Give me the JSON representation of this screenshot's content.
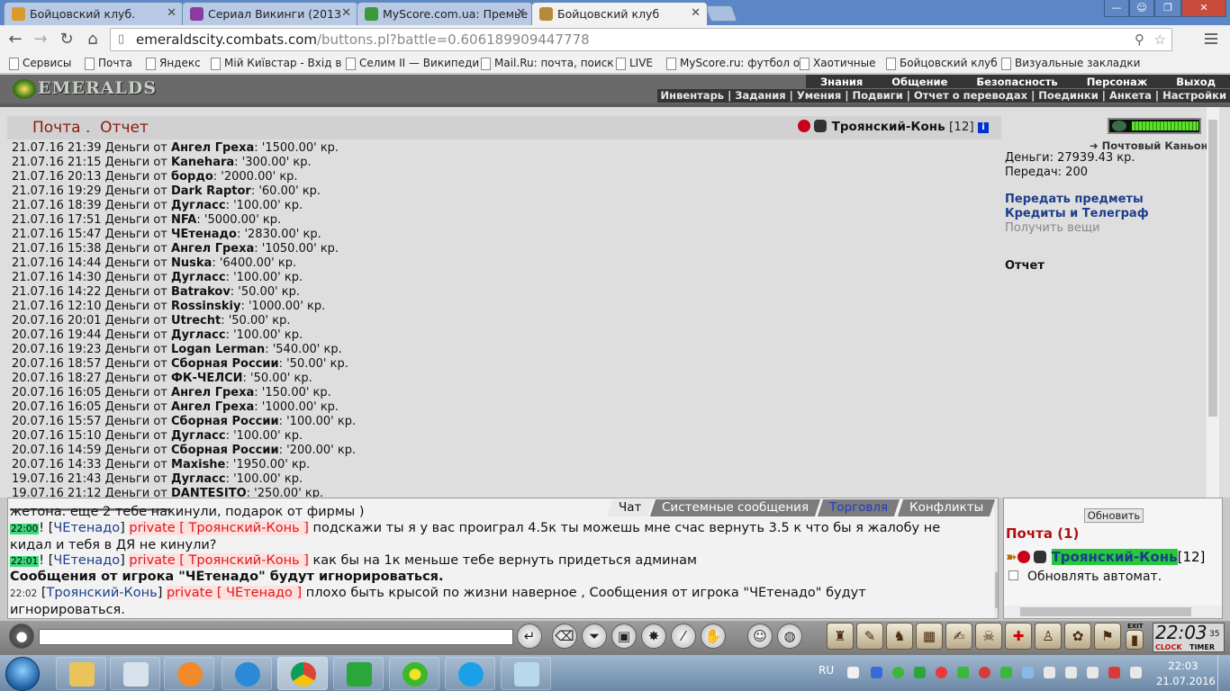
{
  "browser": {
    "tabs": [
      {
        "title": "Бойцовский клуб.",
        "icon_color": "#d89a2a"
      },
      {
        "title": "Сериал Викинги (2013",
        "icon_color": "#8a3aa0"
      },
      {
        "title": "MyScore.com.ua: Премье",
        "icon_color": "#3a9a3a"
      },
      {
        "title": "Бойцовский клуб",
        "icon_color": "#b58a3a"
      }
    ],
    "url_domain": "emeraldscity.combats.com",
    "url_path": "/buttons.pl?battle=0.606189909447778",
    "bookmarks": [
      "Сервисы",
      "Почта",
      "Яндекс",
      "Мій Київстар - Вхід в",
      "Селим II — Википеди",
      "Mail.Ru: почта, поиск",
      "LIVE",
      "MyScore.ru: футбол о",
      "Хаотичные",
      "Бойцовский клуб",
      "Визуальные закладки"
    ]
  },
  "game": {
    "logo": "EMERALDS",
    "top_menu": [
      "Знания",
      "Общение",
      "Безопасность",
      "Персонаж",
      "Выход"
    ],
    "sub_menu": [
      "Инвентарь",
      "Задания",
      "Умения",
      "Подвиги",
      "Отчет о переводах",
      "Поединки",
      "Анкета",
      "Настройки"
    ],
    "page_title_a": "Почта .",
    "page_title_b": "Отчет",
    "player_name": "Троянский-Конь",
    "player_level": "[12]",
    "info_icon": "i",
    "location": "Почтовый Каньон",
    "money_line": "Деньги: 27939.43 кр.",
    "transfers_line": "Передач: 200",
    "links": [
      "Передать предметы",
      "Кредиты и Телеграф"
    ],
    "disabled_link": "Получить вещи",
    "report_label": "Отчет",
    "log": [
      {
        "date": "21.07.16 21:39 Деньги от",
        "name": "Ангел Греха",
        "amount": ": '1500.00' кр."
      },
      {
        "date": "21.07.16 21:15 Деньги от",
        "name": "Kanehara",
        "amount": ": '300.00' кр."
      },
      {
        "date": "21.07.16 20:13 Деньги от",
        "name": "бордо",
        "amount": ": '2000.00' кр."
      },
      {
        "date": "21.07.16 19:29 Деньги от",
        "name": "Dark Raptor",
        "amount": ": '60.00' кр."
      },
      {
        "date": "21.07.16 18:39 Деньги от",
        "name": "Дугласс",
        "amount": ": '100.00' кр."
      },
      {
        "date": "21.07.16 17:51 Деньги от",
        "name": "NFA",
        "amount": ": '5000.00' кр."
      },
      {
        "date": "21.07.16 15:47 Деньги от",
        "name": "ЧЕтенадо",
        "amount": ": '2830.00' кр."
      },
      {
        "date": "21.07.16 15:38 Деньги от",
        "name": "Ангел Греха",
        "amount": ": '1050.00' кр."
      },
      {
        "date": "21.07.16 14:44 Деньги от",
        "name": "Nuska",
        "amount": ": '6400.00' кр."
      },
      {
        "date": "21.07.16 14:30 Деньги от",
        "name": "Дугласс",
        "amount": ": '100.00' кр."
      },
      {
        "date": "21.07.16 14:22 Деньги от",
        "name": "Batrakov",
        "amount": ": '50.00' кр."
      },
      {
        "date": "21.07.16 12:10 Деньги от",
        "name": "Rossinskiy",
        "amount": ": '1000.00' кр."
      },
      {
        "date": "20.07.16 20:01 Деньги от",
        "name": "Utrecht",
        "amount": ": '50.00' кр."
      },
      {
        "date": "20.07.16 19:44 Деньги от",
        "name": "Дугласс",
        "amount": ": '100.00' кр."
      },
      {
        "date": "20.07.16 19:23 Деньги от",
        "name": "Logan Lerman",
        "amount": ": '540.00' кр."
      },
      {
        "date": "20.07.16 18:57 Деньги от",
        "name": "Сборная России",
        "amount": ": '50.00' кр."
      },
      {
        "date": "20.07.16 18:27 Деньги от",
        "name": "ФК-ЧЕЛСИ",
        "amount": ": '50.00' кр."
      },
      {
        "date": "20.07.16 16:05 Деньги от",
        "name": "Ангел Греха",
        "amount": ": '150.00' кр."
      },
      {
        "date": "20.07.16 16:05 Деньги от",
        "name": "Ангел Греха",
        "amount": ": '1000.00' кр."
      },
      {
        "date": "20.07.16 15:57 Деньги от",
        "name": "Сборная России",
        "amount": ": '100.00' кр."
      },
      {
        "date": "20.07.16 15:10 Деньги от",
        "name": "Дугласс",
        "amount": ": '100.00' кр."
      },
      {
        "date": "20.07.16 14:59 Деньги от",
        "name": "Сборная России",
        "amount": ": '200.00' кр."
      },
      {
        "date": "20.07.16 14:33 Деньги от",
        "name": "Maxishe",
        "amount": ": '1950.00' кр."
      },
      {
        "date": "19.07.16 21:43 Деньги от",
        "name": "Дугласс",
        "amount": ": '100.00' кр."
      },
      {
        "date": "19.07.16 21:12 Деньги от",
        "name": "DANTESITO",
        "amount": ": '250.00' кр."
      }
    ]
  },
  "chat": {
    "tabs": [
      "Чат",
      "Системные сообщения",
      "Торговля",
      "Конфликты"
    ],
    "partial_line": "жетона. еще 2 тебе накинули, подарок от фирмы )",
    "messages": [
      {
        "time": "22:00",
        "from": "ЧЕтенадо",
        "private": "private [ Троянский-Конь ]",
        "text": "подскажи ты я у вас проиграл 4.5к ты можешь мне счас вернуть 3.5 к что бы я жалобу не кидал и тебя в ДЯ не кинули?"
      },
      {
        "time": "22:01",
        "from": "ЧЕтенадо",
        "private": "private [ Троянский-Конь ]",
        "text": "как бы на 1к меньше тебе вернуть придеться админам"
      },
      {
        "time": "22:02",
        "from": "Троянский-Конь",
        "private": "private [ ЧЕтенадо ]",
        "text": "плохо быть крысой по жизни наверное , Сообщения от игрока \"ЧЕтенадо\" будут игнорироваться."
      }
    ],
    "ignore_notice": "Сообщения от игрока \"ЧЕтенадо\" будут игнорироваться."
  },
  "online": {
    "refresh_button": "Обновить",
    "mail_label": "Почта (1)",
    "nick": "Троянский-Конь",
    "level": "[12]",
    "auto_refresh_label": "Обновлять автомат."
  },
  "clock": {
    "time": "22:03",
    "seconds": "35",
    "clock_label": "CLOCK",
    "timer_label": "TIMER",
    "exit_label": "EXIT"
  },
  "taskbar": {
    "language": "RU",
    "time": "22:03",
    "date": "21.07.2016"
  }
}
